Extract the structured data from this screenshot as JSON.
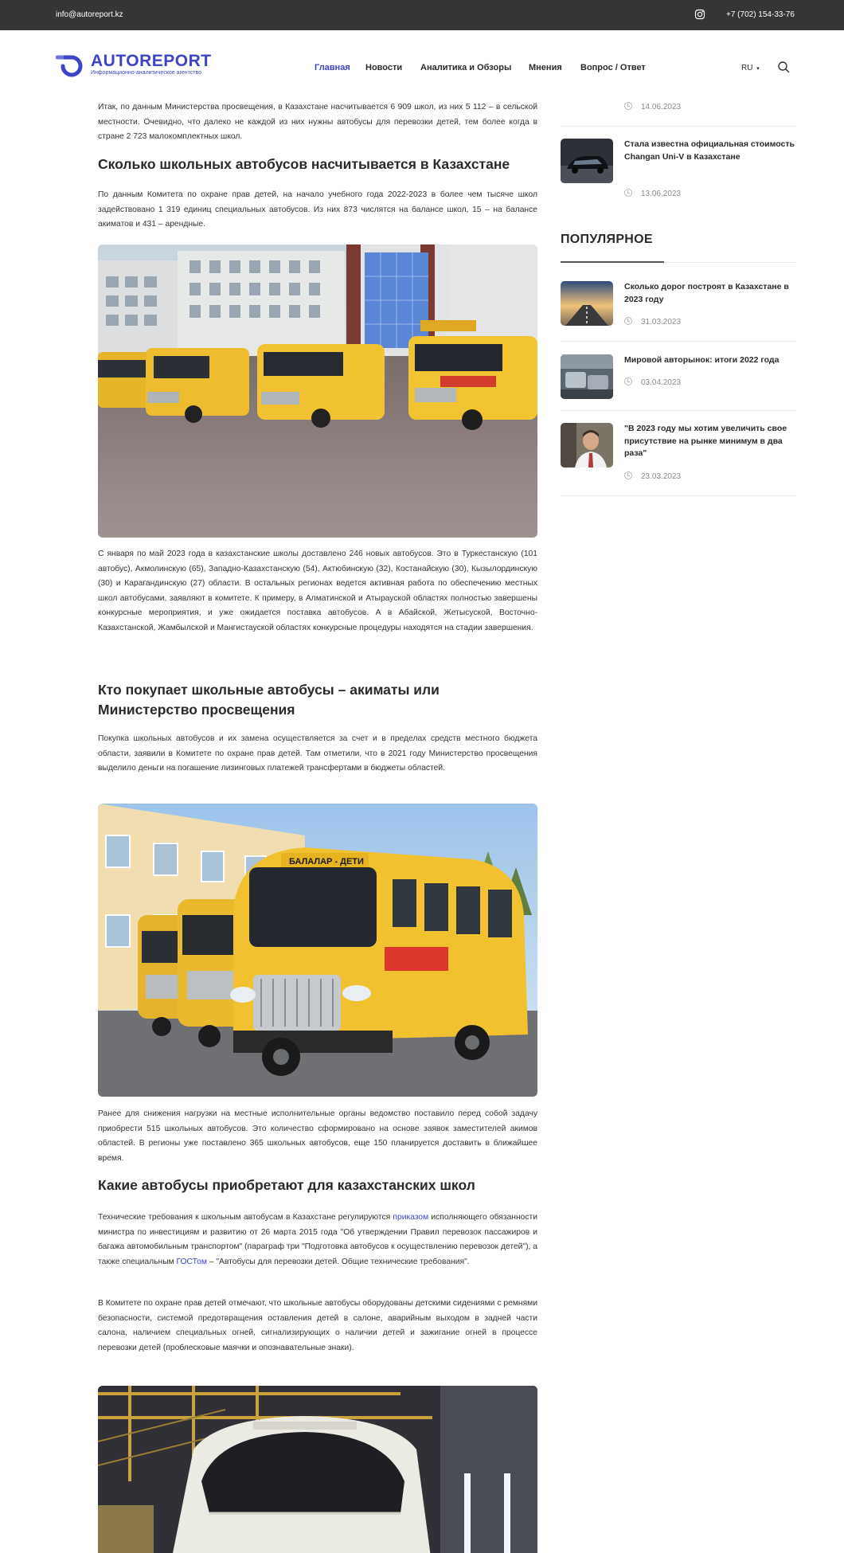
{
  "topbar": {
    "email": "info@autoreport.kz",
    "phone": "+7 (702) 154-33-76",
    "social_icon": "instagram-icon"
  },
  "header": {
    "logo_text": "AUTOREPORT",
    "logo_tagline": "Информационно-аналитическое агентство",
    "nav": [
      "Главная",
      "Новости",
      "Аналитика и Обзоры",
      "Мнения",
      "Вопрос / Ответ"
    ],
    "active_nav": "Главная",
    "lang": "RU",
    "search_icon": "search-icon",
    "accent_color": "#3d44c8"
  },
  "article": {
    "p1": "Итак, по данным Министерства просвещения, в Казахстане насчитывается 6 909 школ, из них 5 112 – в сельской местности. Очевидно, что далеко не каждой из них нужны автобусы для перевозки детей, тем более когда в стране 2 723 малокомплектных школ.",
    "h1": "Сколько школьных автобусов насчитывается в Казахстане",
    "p2": "По данным Комитета по охране прав детей, на начало учебного года 2022-2023 в более чем тысяче школ задействовано 1 319 единиц специальных автобусов. Из них  873 числятся на балансе школ, 15 – на балансе акиматов и 431 – арендные.",
    "p3": "С января по май 2023 года в казахстанские школы доставлено 246 новых автобусов. Это в Туркестанскую (101 автобус), Акмолинскую (65), Западно-Казахстанскую (54), Актюбинскую (32), Костанайскую (30), Кызылординскую (30) и Карагандинскую (27) области. В остальных регионах ведется активная работа по обеспечению местных школ автобусами, заявляют в комитете. К примеру, в Алматинской и Атырауской областях полностью завершены конкурсные мероприятия, и уже ожидается поставка автобусов. А в Абайской, Жетысуской, Восточно-Казахстанской, Жамбылской и Мангистауской областях конкурсные процедуры находятся на стадии завершения.",
    "h2": "Кто покупает школьные автобусы – акиматы или Министерство просвещения",
    "p4": "Покупка школьных автобусов и их замена осуществляется за счет и в пределах средств местного бюджета области, заявили в Комитете по охране прав детей. Там отметили, что в 2021 году Министерство просвещения выделило деньги на погашение лизинговых платежей трансфертами в бюджеты областей.",
    "p5": "Ранее для снижения нагрузки на местные исполнительные органы ведомство поставило перед собой задачу приобрести 515 школьных автобусов. Это количество сформировано на основе заявок заместителей акимов областей. В регионы уже поставлено 365 школьных автобусов, еще 150 планируется доставить в ближайшее время.",
    "h3": "Какие автобусы приобретают для казахстанских школ",
    "p6_a": "Технические требования к школьным автобусам в Казахстане регулируются ",
    "p6_link1": "приказом",
    "p6_b": " исполняющего обязанности министра по инвестициям и развитию от 26 марта 2015 года \"Об утверждении Правил перевозок пассажиров и багажа автомобильным транспортом\" (параграф три \"Подготовка автобусов к осуществлению перевозок детей\"), а также специальным ",
    "p6_link2": "ГОСТом",
    "p6_c": " – \"Автобусы для перевозки детей. Общие технические требования\".",
    "p7": "В Комитете по охране прав детей отмечают, что школьные автобусы оборудованы детскими сидениями с ремнями безопасности, системой предотвращения оставления детей в салоне, аварийным выходом в задней части салона, наличием специальных огней, сигнализирующих о наличии детей и зажигание огней в процессе перевозки детей (проблесковые маячки и опознавательные знаки).",
    "bus_sign_1": "БАЛАЛАР - ДЕТИ",
    "bus_sign_2": "БАЛАЛАР - ДЕТИ"
  },
  "sidebar": {
    "latest": [
      {
        "date": "14.06.2023"
      },
      {
        "title": "Стала известна официальная стоимость Changan Uni-V в Казахстане",
        "date": "13.06.2023"
      }
    ],
    "popular_heading": "ПОПУЛЯРНОЕ",
    "popular": [
      {
        "title": "Сколько дорог построят в Казахстане в 2023 году",
        "date": "31.03.2023"
      },
      {
        "title": "Мировой авторынок: итоги 2022 года",
        "date": "03.04.2023"
      },
      {
        "title": "\"В 2023 году мы хотим увеличить свое присутствие на рынке минимум в два раза\"",
        "date": "23.03.2023"
      }
    ]
  }
}
